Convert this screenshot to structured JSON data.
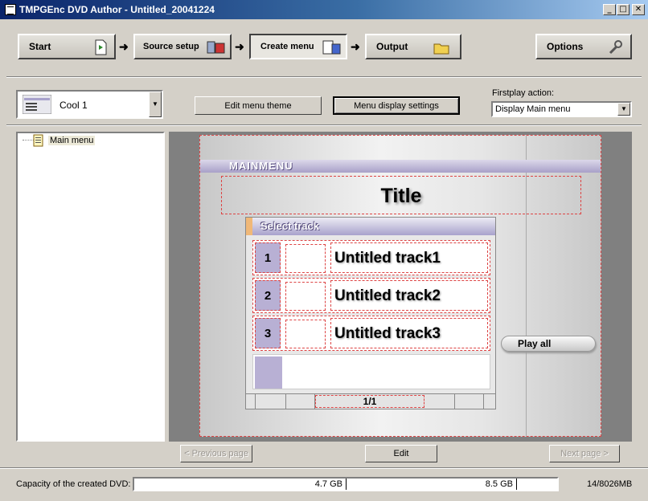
{
  "window": {
    "title": "TMPGEnc DVD Author - Untitled_20041224",
    "minimize_glyph": "_",
    "maximize_glyph": "□",
    "close_glyph": "✕"
  },
  "steps": {
    "start": "Start",
    "source_setup": "Source setup",
    "create_menu": "Create menu",
    "output": "Output",
    "options": "Options",
    "arrow_glyph": "➜"
  },
  "toolbar": {
    "theme_name": "Cool 1",
    "edit_theme": "Edit menu theme",
    "display_settings": "Menu display settings",
    "firstplay_label": "Firstplay action:",
    "firstplay_value": "Display Main menu"
  },
  "tree": {
    "items": [
      {
        "label": "Main menu"
      }
    ]
  },
  "preview": {
    "band_label": "MAINMENU",
    "title": "Title",
    "panel_header": "Select track",
    "tracks": [
      {
        "number": "1",
        "name": "Untitled track1"
      },
      {
        "number": "2",
        "name": "Untitled track2"
      },
      {
        "number": "3",
        "name": "Untitled track3"
      }
    ],
    "page_indicator": "1/1",
    "play_all": "Play all"
  },
  "nav": {
    "previous": "< Previous page",
    "edit": "Edit",
    "next": "Next page >"
  },
  "status": {
    "capacity_label": "Capacity of the created DVD:",
    "marker_single": "4.7 GB",
    "marker_dual": "8.5 GB",
    "usage": "14/8026MB"
  },
  "colors": {
    "titlebar_start": "#0a246a",
    "titlebar_end": "#a6caf0",
    "menu_accent": "#a8a2cc",
    "dashed_guides": "#dd4444"
  }
}
